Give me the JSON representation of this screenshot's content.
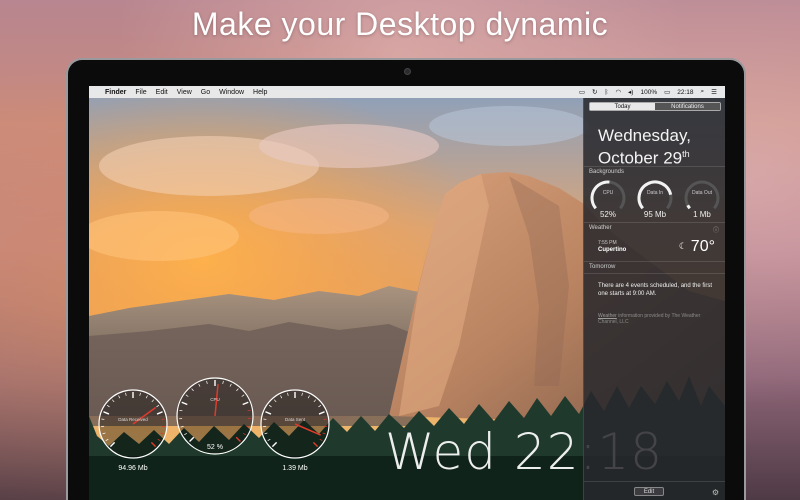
{
  "headline": "Make your Desktop dynamic",
  "menubar": {
    "apple": "",
    "app": "Finder",
    "items": [
      "File",
      "Edit",
      "View",
      "Go",
      "Window",
      "Help"
    ],
    "battery": "100%",
    "clock": "22:18"
  },
  "notification_center": {
    "tabs": {
      "today": "Today",
      "notifications": "Notifications"
    },
    "date_line1": "Wednesday,",
    "date_line2": "October 29",
    "date_suffix": "th",
    "backgrounds_label": "Backgrounds",
    "gauges": [
      {
        "title": "CPU",
        "value": "52%",
        "level": 0.52
      },
      {
        "title": "Data In",
        "value": "95 Mb",
        "level": 0.8
      },
      {
        "title": "Data Out",
        "value": "1 Mb",
        "level": 0.05
      }
    ],
    "weather_label": "Weather",
    "weather_time": "7:55 PM",
    "weather_city": "Cupertino",
    "weather_temp": "70°",
    "tomorrow_label": "Tomorrow",
    "events_text": "There are 4 events scheduled, and the first one starts at 9:00 AM.",
    "provider_link": "Weather",
    "provider_text": " information provided by The Weather Channel, LLC",
    "edit_label": "Edit"
  },
  "desktop_widgets": {
    "gauges": [
      {
        "title": "Data Received",
        "reading": "94.96 Mb",
        "level": 0.7
      },
      {
        "title": "CPU",
        "reading": "52 %",
        "level": 0.52
      },
      {
        "title": "Data Sent",
        "reading": "1.39 Mb",
        "level": 0.92
      }
    ],
    "clock_text": "Wed 22:18"
  },
  "colors": {
    "accent_red": "#e03a2a",
    "gauge_white": "#ffffff"
  }
}
